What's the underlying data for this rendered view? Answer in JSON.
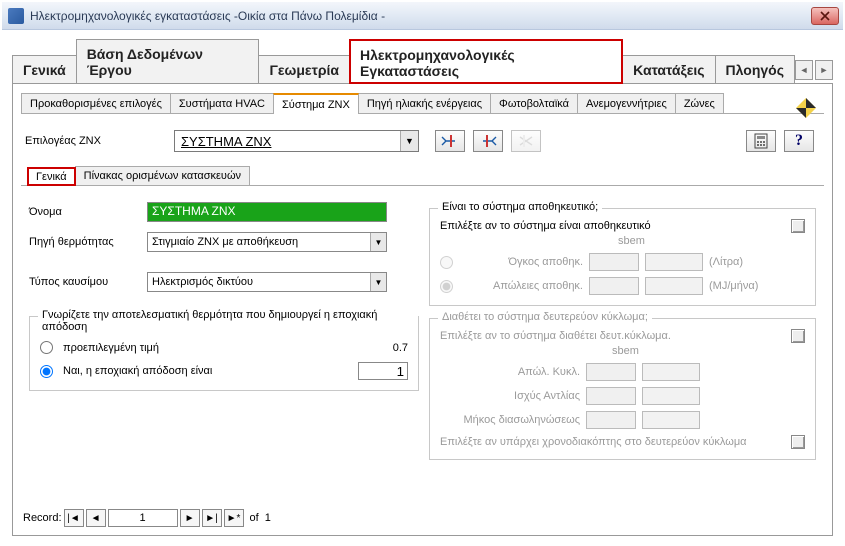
{
  "window": {
    "title": "Ηλεκτρομηχανολογικές εγκαταστάσεις -Οικία στα Πάνω Πολεμίδια -"
  },
  "main_tabs": {
    "t1": "Γενικά",
    "t2": "Βάση Δεδομένων Έργου",
    "t3": "Γεωμετρία",
    "t4": "Ηλεκτρομηχανολογικές Εγκαταστάσεις",
    "t5": "Κατατάξεις",
    "t6": "Πλοηγός"
  },
  "sub_tabs": {
    "s1": "Προκαθορισμένες επιλογές",
    "s2": "Συστήματα HVAC",
    "s3": "Σύστημα ZNX",
    "s4": "Πηγή ηλιακής ενέργειας",
    "s5": "Φωτοβολταϊκά",
    "s6": "Ανεμογεννήτριες",
    "s7": "Ζώνες"
  },
  "selector": {
    "label": "Επιλογέας ZNX",
    "value": "ΣΥΣΤΗΜΑ ZNX"
  },
  "inner_tabs": {
    "i1": "Γενικά",
    "i2": "Πίνακας ορισμένων κατασκευών"
  },
  "form": {
    "name_label": "Όνομα",
    "name_value": "ΣΥΣΤΗΜΑ ZNX",
    "heat_src_label": "Πηγή θερμότητας",
    "heat_src_value": "Στιγμιαίο ZNX με αποθήκευση",
    "fuel_label": "Τύπος καυσίμου",
    "fuel_value": "Ηλεκτρισμός δικτύου"
  },
  "eff_group": {
    "title": "Γνωρίζετε την αποτελεσματική θερμότητα που δημιουργεί η εποχιακή απόδοση",
    "opt1": "προεπιλεγμένη τιμή",
    "opt1_val": "0.7",
    "opt2": "Ναι, η εποχιακή απόδοση είναι",
    "opt2_val": "1"
  },
  "storage_group": {
    "title": "Είναι το σύστημα αποθηκευτικό;",
    "select_label": "Επιλέξτε αν το σύστημα είναι αποθηκευτικό",
    "sbem": "sbem",
    "vol_label": "Όγκος αποθηκ.",
    "vol_unit": "(Λίτρα)",
    "loss_label": "Απώλειες αποθηκ.",
    "loss_unit": "(MJ/μήνα)"
  },
  "secondary_group": {
    "title": "Διαθέτει το σύστημα δευτερεύον κύκλωμα;",
    "select_label": "Επιλέξτε αν το σύστημα διαθέτει δευτ.κύκλωμα.",
    "sbem": "sbem",
    "f1": "Απώλ. Κυκλ.",
    "f2": "Ισχύς Αντλίας",
    "f3": "Μήκος διασωληνώσεως",
    "timer_label": "Επιλέξτε αν υπάρχει χρονοδιακόπτης στο δευτερεύον κύκλωμα"
  },
  "record": {
    "label": "Record:",
    "value": "1",
    "of": "of",
    "total": "1"
  }
}
